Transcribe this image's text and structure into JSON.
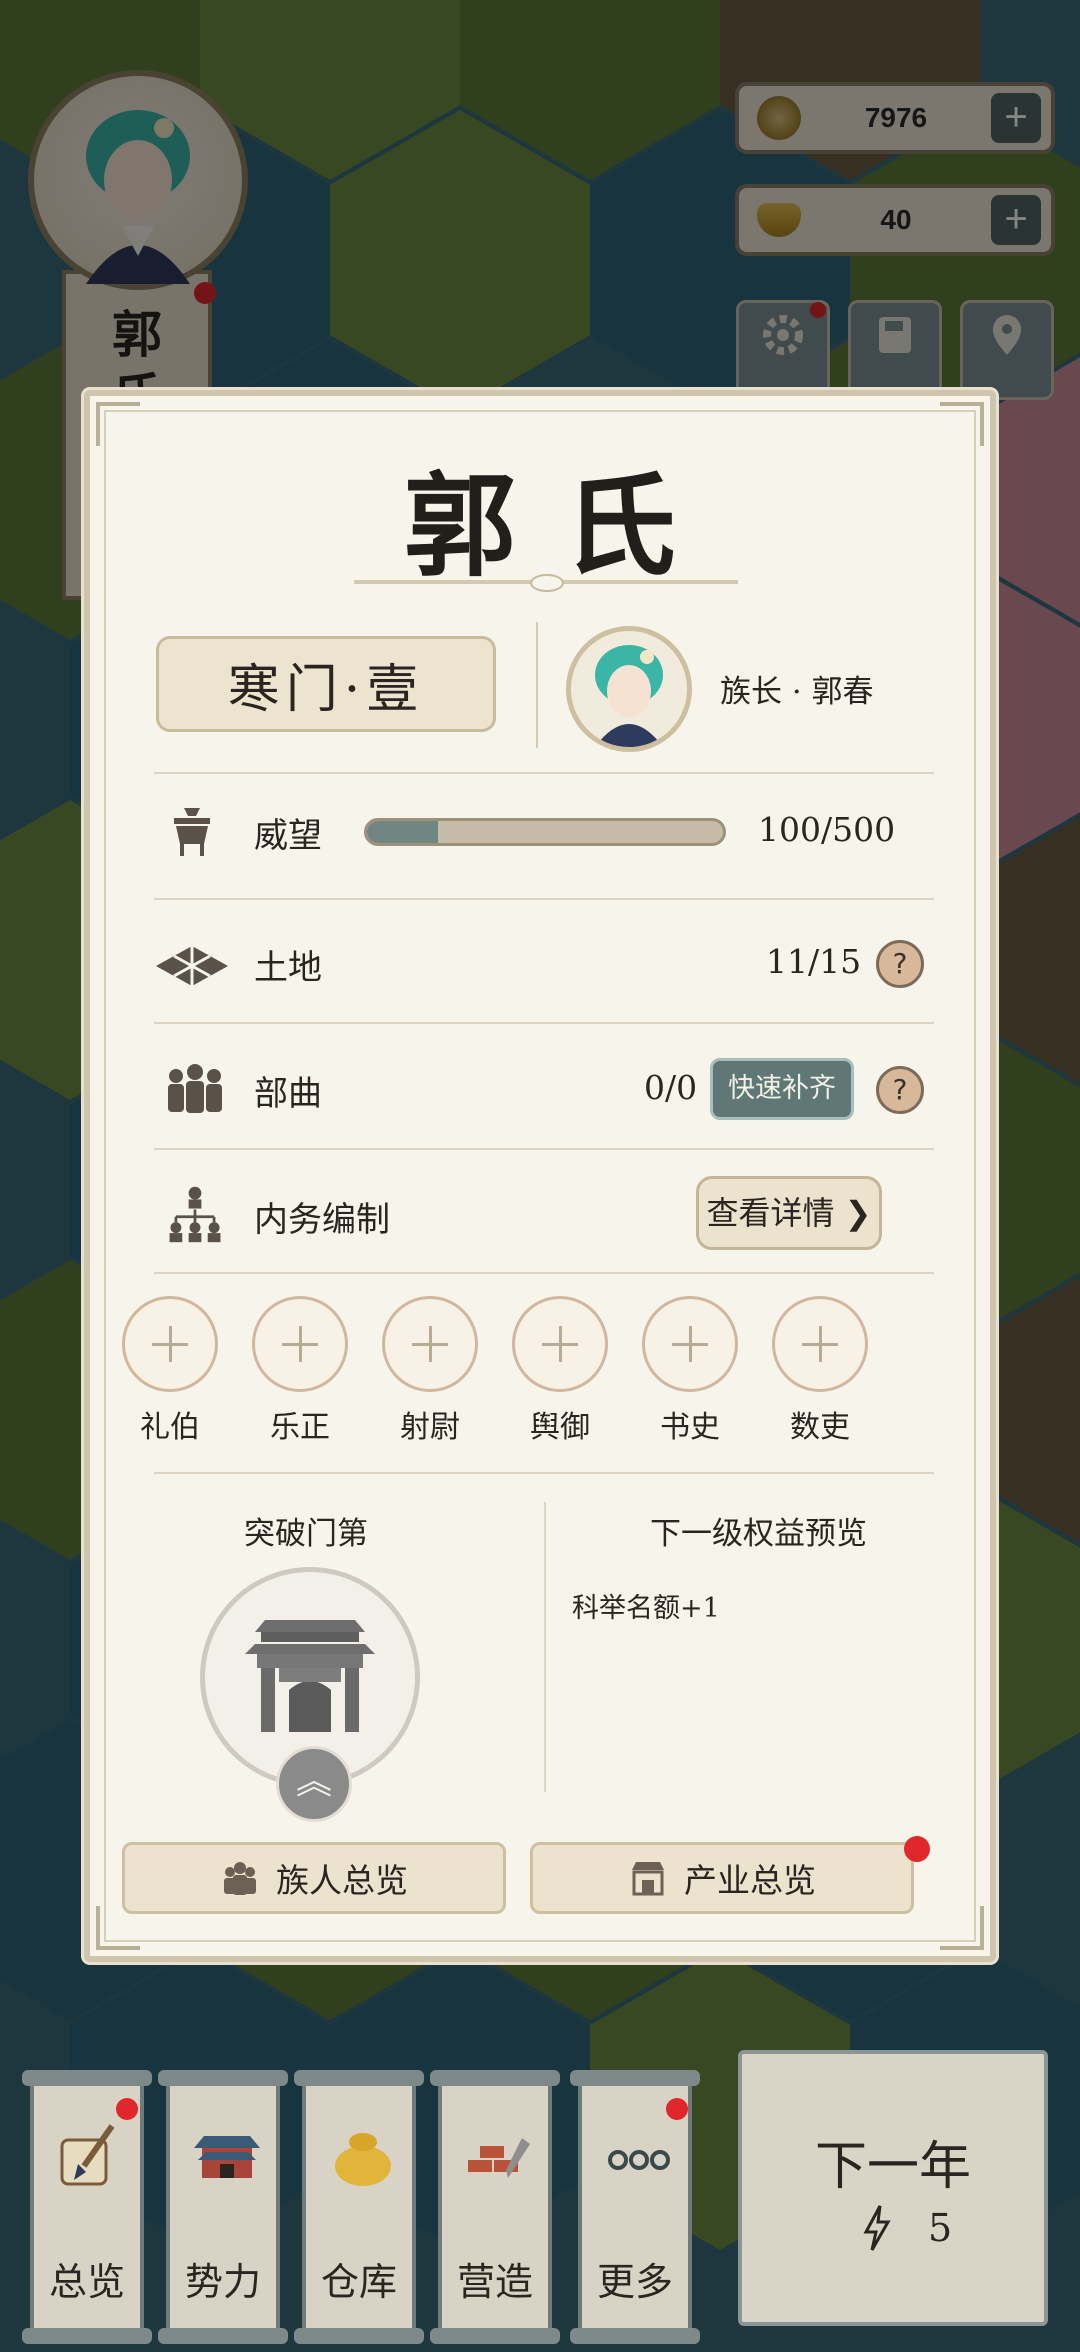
{
  "clan_banner": {
    "chars": [
      "郭",
      "氏"
    ]
  },
  "resources": [
    {
      "icon": "coin-icon",
      "value": "7976",
      "plus": "+"
    },
    {
      "icon": "gold-ingot-icon",
      "value": "40",
      "plus": "+"
    }
  ],
  "panel": {
    "title": "郭氏",
    "rank": "寒门·壹",
    "leader": "族长 · 郭春",
    "rows": {
      "prestige": {
        "label": "威望",
        "value": "100/500",
        "fraction": 0.2
      },
      "land": {
        "label": "土地",
        "value": "11/15",
        "help": "?"
      },
      "troops": {
        "label": "部曲",
        "value": "0/0",
        "quick_fill": "快速补齐",
        "help": "?"
      },
      "affairs": {
        "label": "内务编制",
        "details": "查看详情 ❯"
      }
    },
    "slots": [
      "礼伯",
      "乐正",
      "射尉",
      "舆御",
      "书史",
      "数吏"
    ],
    "breakthrough": {
      "title": "突破门第",
      "up_icon": "double-chevron-up-icon",
      "up_glyph": "︽"
    },
    "next_level": {
      "title": "下一级权益预览",
      "benefit": "科举名额+1"
    },
    "bottom_buttons": {
      "members": "族人总览",
      "industry": "产业总览"
    }
  },
  "nav": [
    "总览",
    "势力",
    "仓库",
    "营造",
    "更多"
  ],
  "next_year": {
    "title": "下一年",
    "energy": "5"
  },
  "colors": {
    "panel_bg": "#f7f4ec",
    "accent_teal": "#5f7875",
    "notification_red": "#e0272b"
  }
}
